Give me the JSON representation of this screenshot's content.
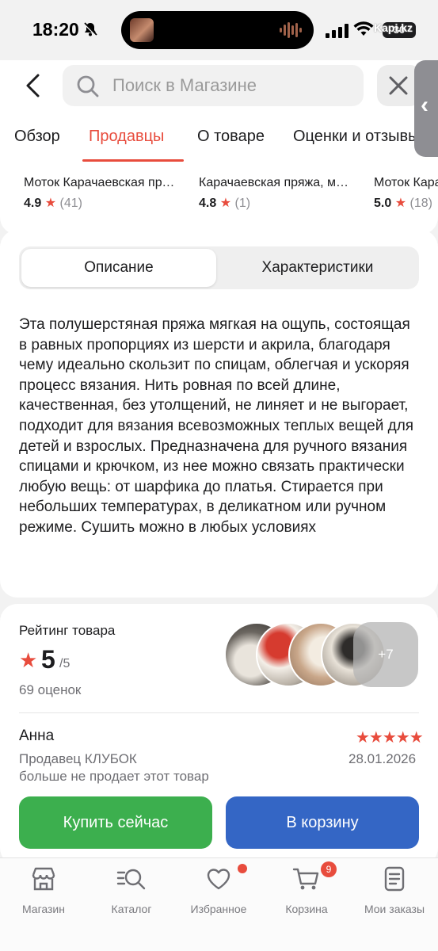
{
  "status_bar": {
    "time": "18:20",
    "battery": "30",
    "watermark": "Kapi.kz"
  },
  "header": {
    "search_placeholder": "Поиск в Магазине",
    "tabs": [
      {
        "label": "Обзор",
        "active": false
      },
      {
        "label": "Продавцы",
        "active": true
      },
      {
        "label": "О товаре",
        "active": false
      },
      {
        "label": "Оценки и отзывы",
        "active": false
      }
    ]
  },
  "sellers": [
    {
      "name": "Моток Карачаевская пряжа",
      "rating": "4.9",
      "count": "(41)"
    },
    {
      "name": "Карачаевская пряжа, моток",
      "rating": "4.8",
      "count": "(1)"
    },
    {
      "name": "Моток Карачаевская",
      "rating": "5.0",
      "count": "(18)"
    }
  ],
  "description": {
    "tabs": [
      {
        "label": "Описание",
        "active": true
      },
      {
        "label": "Характеристики",
        "active": false
      }
    ],
    "text": "Эта полушерстяная пряжа мягкая на ощупь, состоящая в равных пропорциях из шерсти и акрила, благодаря чему идеально скользит по спицам, облегчая и ускоряя процесс вязания. Нить ровная по всей длине, качественная, без утолщений, не линяет и не выгорает, подходит для вязания всевозможных теплых вещей для детей и взрослых. Предназначена для ручного вязания спицами и крючком, из нее можно связать практически любую вещь: от шарфика до платья. Стирается при небольших температурах, в деликатном или ручном режиме. Сушить можно в любых условиях"
  },
  "rating": {
    "title": "Рейтинг товара",
    "value": "5",
    "max": "/5",
    "count": "69 оценок",
    "photos_more": "+7"
  },
  "review": {
    "author": "Анна",
    "stars": 5,
    "seller": "Продавец КЛУБОК",
    "date": "28.01.2026",
    "note": "больше не продает этот товар"
  },
  "actions": {
    "buy": "Купить сейчас",
    "cart": "В корзину"
  },
  "bottom_nav": [
    {
      "label": "Магазин",
      "icon": "store-icon"
    },
    {
      "label": "Каталог",
      "icon": "catalog-search-icon"
    },
    {
      "label": "Избранное",
      "icon": "heart-icon"
    },
    {
      "label": "Корзина",
      "icon": "cart-icon",
      "badge": "9"
    },
    {
      "label": "Мои заказы",
      "icon": "orders-icon"
    }
  ],
  "colors": {
    "accent": "#e84c3d",
    "buy": "#3caf4e",
    "cart": "#3466c5"
  }
}
